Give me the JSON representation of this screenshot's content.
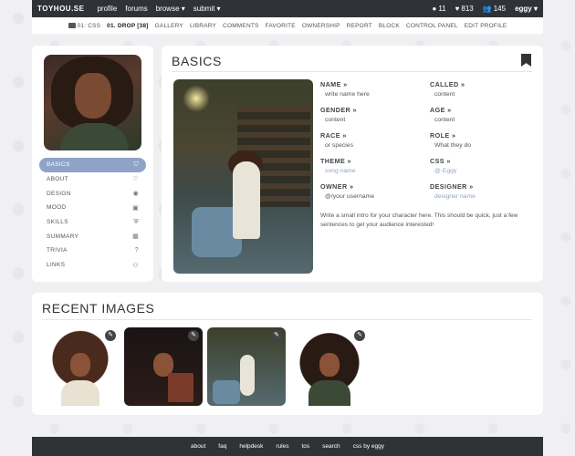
{
  "topnav": {
    "brand": "TOYHOU.SE",
    "links": [
      "profile",
      "forums",
      "browse ▾",
      "submit ▾"
    ],
    "notifications": "11",
    "favorites": "813",
    "watchers": "145",
    "user": "eggy ▾"
  },
  "subnav": {
    "items": [
      "01: CSS",
      "01. DROP [38]",
      "GALLERY",
      "LIBRARY",
      "COMMENTS",
      "FAVORITE",
      "OWNERSHIP",
      "REPORT",
      "BLOCK",
      "CONTROL PANEL",
      "EDIT PROFILE"
    ]
  },
  "sidebar": {
    "items": [
      {
        "label": "BASICS",
        "icon": "bookmark-icon"
      },
      {
        "label": "ABOUT",
        "icon": "heart-icon"
      },
      {
        "label": "DESIGN",
        "icon": "user-icon"
      },
      {
        "label": "MOOD",
        "icon": "image-icon"
      },
      {
        "label": "SKILLS",
        "icon": "shield-icon"
      },
      {
        "label": "SUMMARY",
        "icon": "calculator-icon"
      },
      {
        "label": "TRIVIA",
        "icon": "question-icon"
      },
      {
        "label": "LINKS",
        "icon": "users-icon"
      }
    ]
  },
  "main": {
    "title": "BASICS",
    "fields": {
      "name": {
        "label": "NAME »",
        "value": "write name here"
      },
      "called": {
        "label": "CALLED »",
        "value": "content"
      },
      "gender": {
        "label": "GENDER »",
        "value": "content"
      },
      "age": {
        "label": "AGE »",
        "value": "content"
      },
      "race": {
        "label": "RACE »",
        "value": "or species"
      },
      "role": {
        "label": "ROLE »",
        "value": "What they do"
      },
      "theme": {
        "label": "THEME »",
        "value": "song name"
      },
      "css": {
        "label": "CSS »",
        "value": "@ Eggy"
      },
      "owner": {
        "label": "OWNER »",
        "value": "@/your username"
      },
      "designer": {
        "label": "DESIGNER »",
        "value": "designer name"
      }
    },
    "intro": "Write a small intro for your character here. This should be quick, just a few sentences to get your audience interested!"
  },
  "recent": {
    "title": "RECENT IMAGES",
    "edit_glyph": "✎"
  },
  "footer": {
    "links": [
      "about",
      "faq",
      "helpdesk",
      "rules",
      "tos",
      "search",
      "css by eggy"
    ]
  },
  "colors": {
    "accent": "#8fa2c8",
    "nav_bg": "#2f3338",
    "page_bg": "#f0f0f2"
  }
}
